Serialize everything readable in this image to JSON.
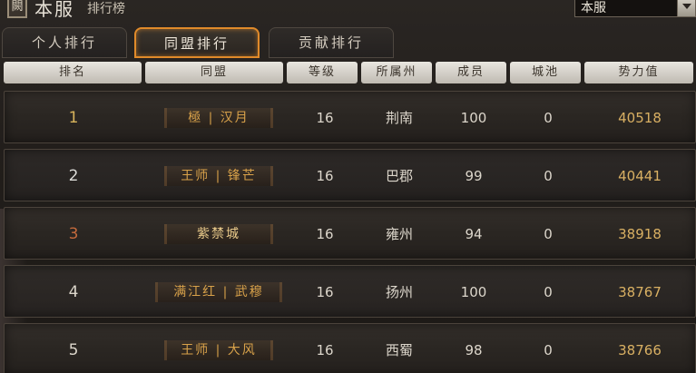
{
  "header": {
    "emblem": "闕",
    "title": "本服",
    "subtitle": "排行榜",
    "server_select": {
      "value": "本服"
    }
  },
  "tabs": [
    {
      "label": "个人排行",
      "active": false
    },
    {
      "label": "同盟排行",
      "active": true
    },
    {
      "label": "贡献排行",
      "active": false
    }
  ],
  "columns": [
    "排名",
    "同盟",
    "等级",
    "所属州",
    "成员",
    "城池",
    "势力值"
  ],
  "rows": [
    {
      "rank": "1",
      "alliance": "極 | 汉月",
      "level": "16",
      "region": "荆南",
      "members": "100",
      "cities": "0",
      "power": "40518"
    },
    {
      "rank": "2",
      "alliance": "王师 | 锋芒",
      "level": "16",
      "region": "巴郡",
      "members": "99",
      "cities": "0",
      "power": "40441"
    },
    {
      "rank": "3",
      "alliance": "紫禁城",
      "level": "16",
      "region": "雍州",
      "members": "94",
      "cities": "0",
      "power": "38918"
    },
    {
      "rank": "4",
      "alliance": "满江红 | 武穆",
      "level": "16",
      "region": "扬州",
      "members": "100",
      "cities": "0",
      "power": "38767"
    },
    {
      "rank": "5",
      "alliance": "王师 | 大风",
      "level": "16",
      "region": "西蜀",
      "members": "98",
      "cities": "0",
      "power": "38766"
    }
  ],
  "colors": {
    "active_tab_border": "#e08a2a",
    "rank1": "#d8b45c",
    "rank3": "#c46a3c",
    "alliance_name": "#d9a24a",
    "power": "#d9b063"
  }
}
